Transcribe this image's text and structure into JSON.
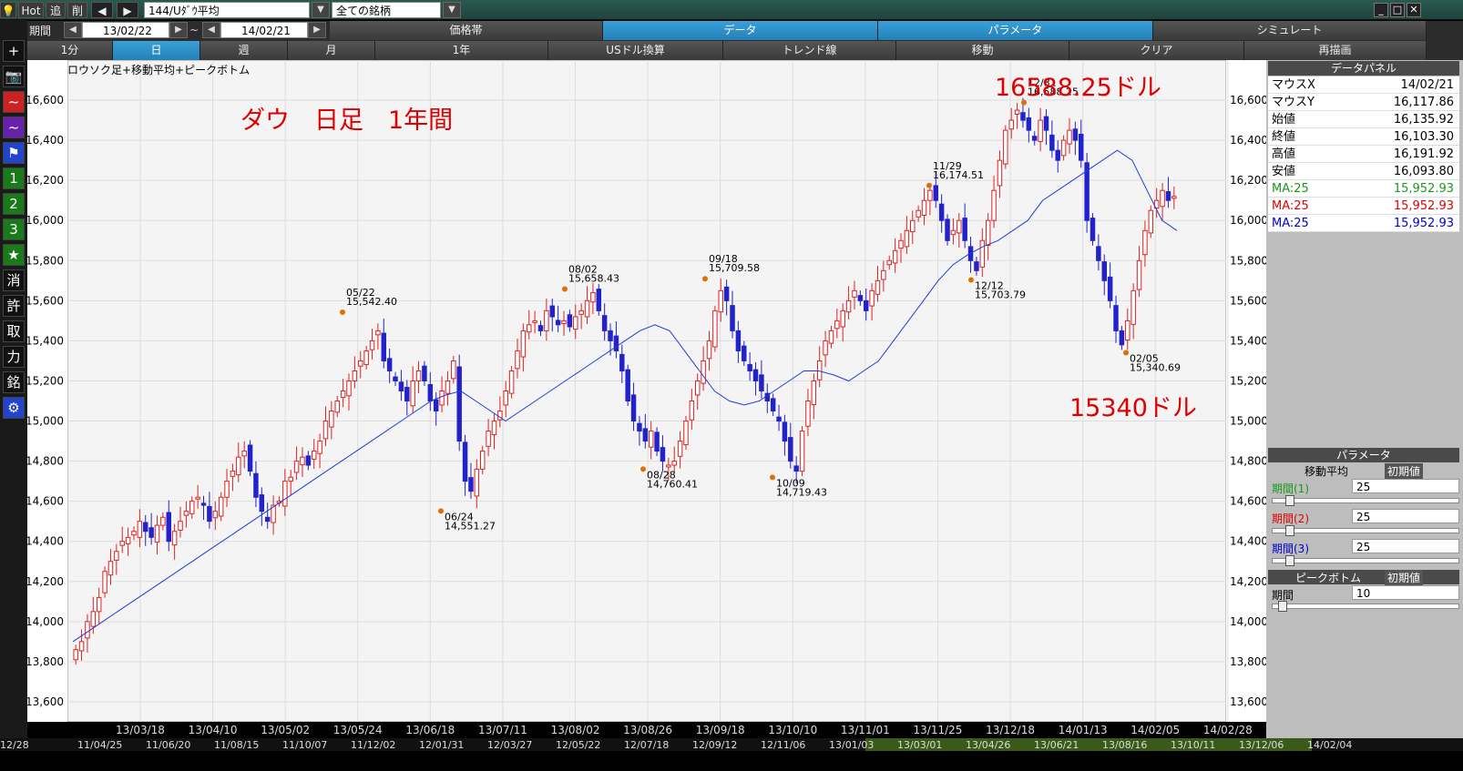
{
  "toolbar": {
    "hot": "Hot",
    "add": "追",
    "del": "削",
    "symbol": "144/Uﾀﾞｳ平均",
    "market": "全ての銘柄",
    "period_label": "期間",
    "date_from": "13/02/22",
    "tilde": "~",
    "date_to": "14/02/21"
  },
  "tabs_row1": [
    {
      "label": "価格帯",
      "active": false
    },
    {
      "label": "データ",
      "active": true
    },
    {
      "label": "パラメータ",
      "active": true
    },
    {
      "label": "シミュレート",
      "active": false
    }
  ],
  "tabs_row2": [
    {
      "label": "1分",
      "active": false
    },
    {
      "label": "日",
      "active": true
    },
    {
      "label": "週",
      "active": false
    },
    {
      "label": "月",
      "active": false
    },
    {
      "label": "1年",
      "active": false
    },
    {
      "label": "USドル換算",
      "active": false
    },
    {
      "label": "トレンド線",
      "active": false
    },
    {
      "label": "移動",
      "active": false
    },
    {
      "label": "クリア",
      "active": false
    },
    {
      "label": "再描画",
      "active": false
    }
  ],
  "left_tools": [
    "+",
    "📷",
    "~",
    "~",
    "⚑",
    "1",
    "2",
    "3",
    "★",
    "消",
    "許",
    "取",
    "力",
    "銘",
    "⚙"
  ],
  "chart_title": "ロウソク足+移動平均+ピークボトム",
  "annotations": {
    "main": "ダウ　日足　1年間",
    "high": "16588.25ドル",
    "low": "15340ドル"
  },
  "chart_data": {
    "type": "candlestick",
    "ylim": [
      13500,
      16800
    ],
    "y_ticks": [
      13600,
      13800,
      14000,
      14200,
      14400,
      14600,
      14800,
      15000,
      15200,
      15400,
      15600,
      15800,
      16000,
      16200,
      16400,
      16600
    ],
    "y_tick_labels": [
      "13,600",
      "13,800",
      "14,000",
      "14,200",
      "14,400",
      "14,600",
      "14,800",
      "15,000",
      "15,200",
      "15,400",
      "15,600",
      "15,800",
      "16,000",
      "16,200",
      "16,400",
      "16,600"
    ],
    "x_tick_labels": [
      "13/03/18",
      "13/04/10",
      "13/05/02",
      "13/05/24",
      "13/06/18",
      "13/07/11",
      "13/08/02",
      "13/08/26",
      "13/09/18",
      "13/10/10",
      "13/11/01",
      "13/11/25",
      "13/12/18",
      "14/01/13",
      "14/02/05",
      "14/02/28"
    ],
    "peaks": [
      {
        "date": "05/22",
        "value": "15,542.40",
        "v": 15542.4,
        "type": "peak"
      },
      {
        "date": "06/24",
        "value": "14,551.27",
        "v": 14551.27,
        "type": "bottom"
      },
      {
        "date": "08/02",
        "value": "15,658.43",
        "v": 15658.43,
        "type": "peak"
      },
      {
        "date": "08/28",
        "value": "14,760.41",
        "v": 14760.41,
        "type": "bottom"
      },
      {
        "date": "09/18",
        "value": "15,709.58",
        "v": 15709.58,
        "type": "peak"
      },
      {
        "date": "10/09",
        "value": "14,719.43",
        "v": 14719.43,
        "type": "bottom"
      },
      {
        "date": "11/29",
        "value": "16,174.51",
        "v": 16174.51,
        "type": "peak"
      },
      {
        "date": "12/12",
        "value": "15,703.79",
        "v": 15703.79,
        "type": "bottom"
      },
      {
        "date": "12/31",
        "value": "16,588.25",
        "v": 16588.25,
        "type": "peak"
      },
      {
        "date": "02/05",
        "value": "15,340.69",
        "v": 15340.69,
        "type": "bottom"
      }
    ],
    "close_path": [
      13860,
      13900,
      14000,
      14050,
      14120,
      14250,
      14300,
      14350,
      14400,
      14420,
      14450,
      14500,
      14450,
      14420,
      14480,
      14520,
      14400,
      14450,
      14500,
      14550,
      14600,
      14620,
      14580,
      14500,
      14550,
      14620,
      14700,
      14750,
      14820,
      14850,
      14750,
      14620,
      14550,
      14500,
      14580,
      14600,
      14700,
      14720,
      14800,
      14820,
      14780,
      14850,
      14900,
      15000,
      15050,
      15100,
      15150,
      15200,
      15250,
      15300,
      15350,
      15400,
      15450,
      15300,
      15250,
      15200,
      15150,
      15100,
      15200,
      15250,
      15200,
      15100,
      15050,
      15150,
      15200,
      15300,
      14900,
      14700,
      14650,
      14760,
      14850,
      14950,
      15000,
      15050,
      15150,
      15250,
      15350,
      15450,
      15480,
      15500,
      15450,
      15550,
      15520,
      15480,
      15500,
      15470,
      15520,
      15550,
      15600,
      15640,
      15550,
      15450,
      15400,
      15350,
      15250,
      15100,
      15000,
      14950,
      14900,
      14950,
      14850,
      14800,
      14780,
      14800,
      14900,
      15000,
      15100,
      15200,
      15300,
      15400,
      15550,
      15650,
      15600,
      15450,
      15350,
      15300,
      15250,
      15200,
      15150,
      15100,
      15050,
      15000,
      14900,
      14800,
      14750,
      14950,
      15100,
      15200,
      15300,
      15400,
      15450,
      15500,
      15550,
      15600,
      15650,
      15600,
      15550,
      15650,
      15700,
      15750,
      15800,
      15850,
      15900,
      15950,
      16000,
      16050,
      16100,
      16150,
      16100,
      16000,
      15900,
      15950,
      16000,
      15900,
      15800,
      15750,
      15900,
      16000,
      16150,
      16300,
      16450,
      16500,
      16550,
      16500,
      16450,
      16400,
      16500,
      16450,
      16350,
      16300,
      16400,
      16450,
      16400,
      16300,
      16000,
      15900,
      15800,
      15700,
      15600,
      15450,
      15380,
      15500,
      15650,
      15800,
      15950,
      16050,
      16100,
      16150,
      16100,
      16120
    ]
  },
  "moving_average_path": [
    13900,
    13950,
    14000,
    14050,
    14100,
    14150,
    14200,
    14250,
    14300,
    14350,
    14400,
    14450,
    14500,
    14550,
    14600,
    14650,
    14700,
    14750,
    14800,
    14850,
    14900,
    14950,
    15000,
    15050,
    15100,
    15130,
    15150,
    15100,
    15050,
    15000,
    15050,
    15100,
    15150,
    15200,
    15250,
    15300,
    15350,
    15400,
    15450,
    15480,
    15450,
    15350,
    15250,
    15150,
    15100,
    15080,
    15100,
    15150,
    15200,
    15250,
    15250,
    15230,
    15200,
    15250,
    15300,
    15400,
    15500,
    15600,
    15700,
    15780,
    15830,
    15870,
    15900,
    15950,
    16000,
    16100,
    16150,
    16200,
    16250,
    16300,
    16350,
    16300,
    16150,
    16000,
    15950
  ],
  "data_panel": {
    "header": "データパネル",
    "rows": [
      {
        "k": "マウスX",
        "v": "14/02/21",
        "color": "#000"
      },
      {
        "k": "マウスY",
        "v": "16,117.86",
        "color": "#000"
      },
      {
        "k": "始値",
        "v": "16,135.92",
        "color": "#000"
      },
      {
        "k": "終値",
        "v": "16,103.30",
        "color": "#000"
      },
      {
        "k": "高値",
        "v": "16,191.92",
        "color": "#000"
      },
      {
        "k": "安値",
        "v": "16,093.80",
        "color": "#000"
      },
      {
        "k": "MA:25",
        "v": "15,952.93",
        "color": "#1a9a1a"
      },
      {
        "k": "MA:25",
        "v": "15,952.93",
        "color": "#e00000"
      },
      {
        "k": "MA:25",
        "v": "15,952.93",
        "color": "#0000cc"
      }
    ]
  },
  "param_panel": {
    "header": "パラメータ",
    "ma_label": "移動平均",
    "init": "初期値",
    "p1": "期間(1)",
    "p1v": "25",
    "p2": "期間(2)",
    "p2v": "25",
    "p3": "期間(3)",
    "p3v": "25",
    "pb_label": "ピークボトム",
    "pb_init": "初期値",
    "pb_p": "期間",
    "pb_pv": "10"
  },
  "bottom_dates": [
    "12/28",
    "11/04/25",
    "11/06/20",
    "11/08/15",
    "11/10/07",
    "11/12/02",
    "12/01/31",
    "12/03/27",
    "12/05/22",
    "12/07/18",
    "12/09/12",
    "12/11/06",
    "13/01/03",
    "13/03/01",
    "13/04/26",
    "13/06/21",
    "13/08/16",
    "13/10/11",
    "13/12/06",
    "14/02/04"
  ]
}
